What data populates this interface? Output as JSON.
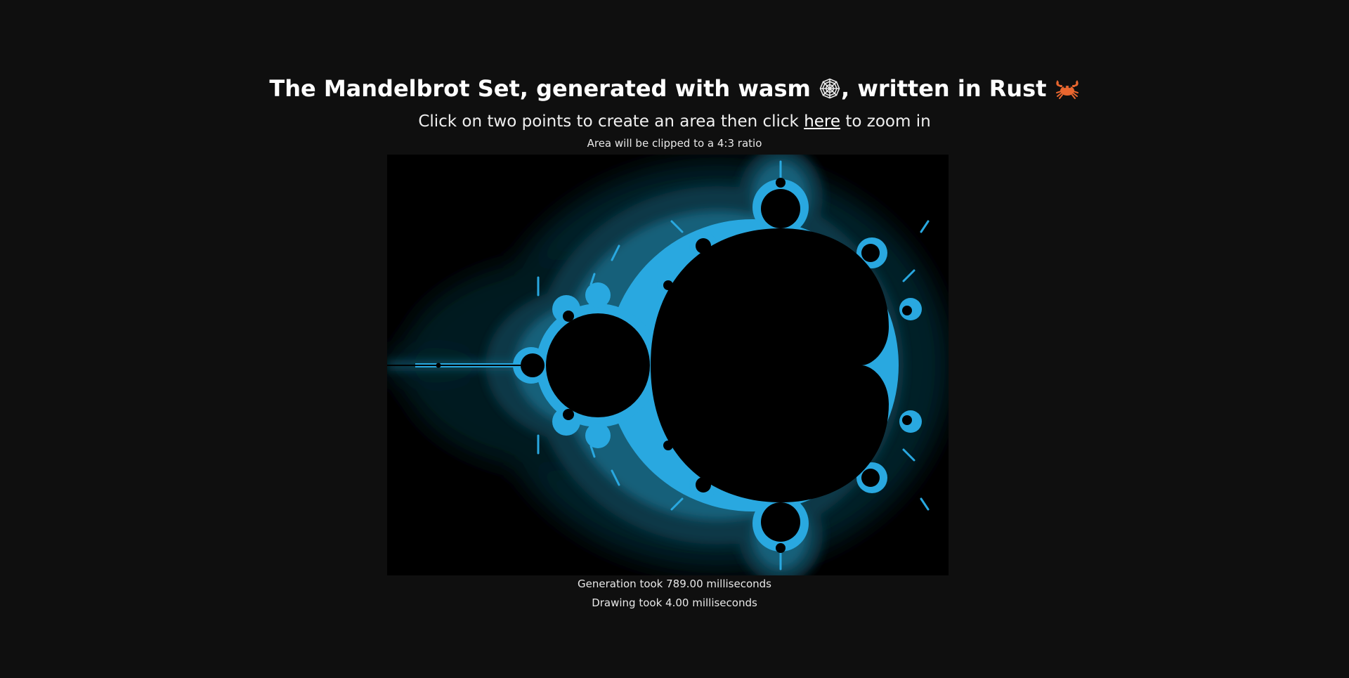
{
  "header": {
    "title_part1": "The Mandelbrot Set, generated with wasm",
    "title_part2": ", written in Rust",
    "wasm_icon": "spider-web-icon",
    "rust_icon": "crab-icon"
  },
  "instructions": {
    "text_before": "Click on two points to create an area then click",
    "link_label": "here",
    "text_after": "to zoom in",
    "note": "Area will be clipped to a 4:3 ratio"
  },
  "stats": {
    "generation": "Generation took 789.00 milliseconds",
    "drawing": "Drawing took 4.00 milliseconds"
  },
  "colors": {
    "page_background": "#0f0f0f",
    "set_interior": "#000000",
    "fractal_edge": "#29a8e0",
    "fractal_glow": "#0b3a48"
  }
}
